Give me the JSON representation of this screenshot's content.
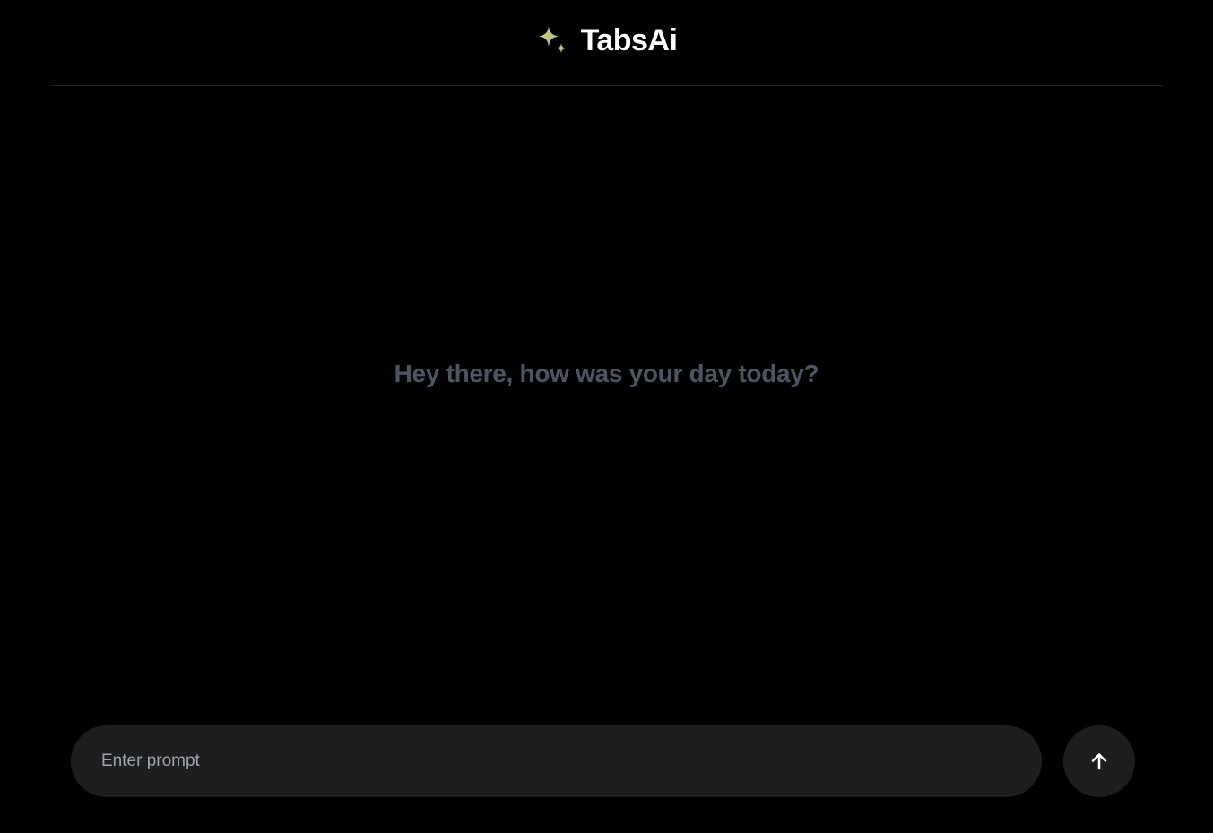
{
  "header": {
    "title": "TabsAi",
    "logo_icon": "sparkle-icon",
    "logo_colors": [
      "#e8c46a",
      "#8fc99a"
    ]
  },
  "main": {
    "greeting": "Hey there, how was your day today?"
  },
  "composer": {
    "placeholder": "Enter prompt",
    "value": "",
    "send_icon": "arrow-up-icon"
  },
  "colors": {
    "background": "#000000",
    "surface": "#1e1e1e",
    "greeting_text": "#4b5563",
    "divider": "#1f1f1f"
  }
}
